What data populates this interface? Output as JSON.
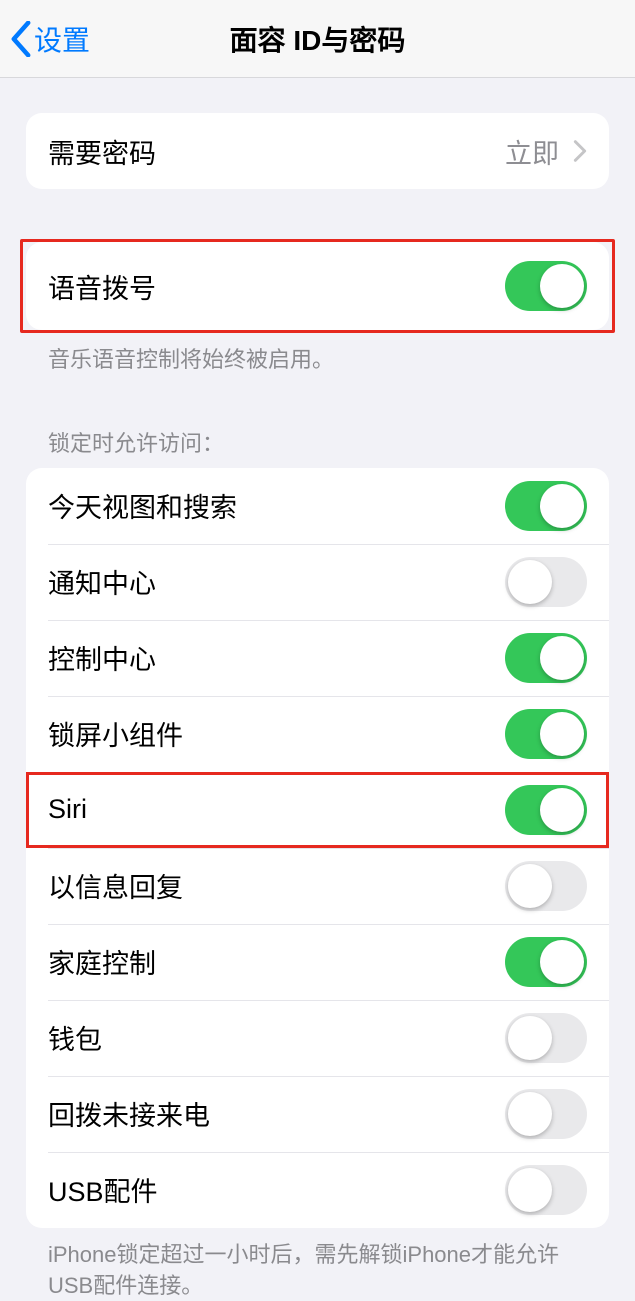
{
  "header": {
    "back_label": "设置",
    "title": "面容 ID与密码"
  },
  "passcode_group": {
    "require_passcode_label": "需要密码",
    "require_passcode_value": "立即"
  },
  "voice_dial": {
    "label": "语音拨号",
    "footer": "音乐语音控制将始终被启用。",
    "enabled": true
  },
  "lock_access": {
    "header": "锁定时允许访问：",
    "items": [
      {
        "label": "今天视图和搜索",
        "enabled": true,
        "highlighted": false
      },
      {
        "label": "通知中心",
        "enabled": false,
        "highlighted": false
      },
      {
        "label": "控制中心",
        "enabled": true,
        "highlighted": false
      },
      {
        "label": "锁屏小组件",
        "enabled": true,
        "highlighted": false
      },
      {
        "label": "Siri",
        "enabled": true,
        "highlighted": true
      },
      {
        "label": "以信息回复",
        "enabled": false,
        "highlighted": false
      },
      {
        "label": "家庭控制",
        "enabled": true,
        "highlighted": false
      },
      {
        "label": "钱包",
        "enabled": false,
        "highlighted": false
      },
      {
        "label": "回拨未接来电",
        "enabled": false,
        "highlighted": false
      },
      {
        "label": "USB配件",
        "enabled": false,
        "highlighted": false
      }
    ],
    "footer": "iPhone锁定超过一小时后，需先解锁iPhone才能允许USB配件连接。"
  }
}
